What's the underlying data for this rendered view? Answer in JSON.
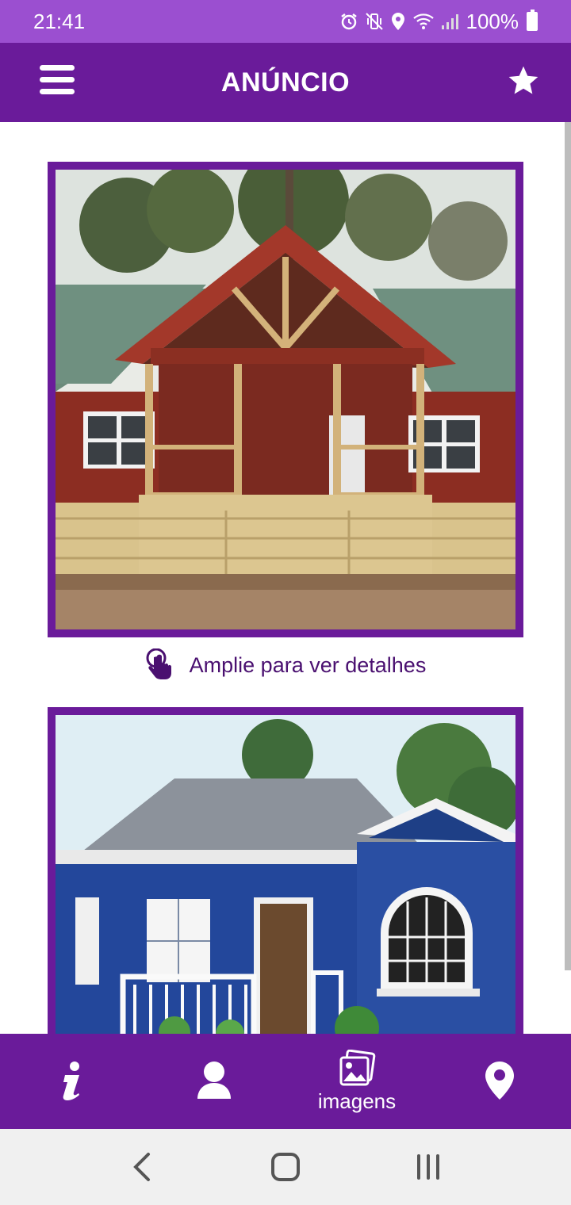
{
  "status_bar": {
    "time": "21:41",
    "battery": "100%",
    "icons": [
      "alarm-icon",
      "vibrate-icon",
      "location-icon",
      "wifi-icon",
      "signal-icon",
      "battery-icon"
    ]
  },
  "app_bar": {
    "title": "ANÚNCIO",
    "menu_icon": "hamburger-menu-icon",
    "favorite_icon": "star-icon"
  },
  "content": {
    "images": [
      {
        "description_icon": "photo-house-red"
      },
      {
        "description_icon": "photo-house-blue"
      }
    ],
    "zoom_hint": "Amplie para ver detalhes"
  },
  "bottom_nav": {
    "items": [
      {
        "icon": "info-icon",
        "label": ""
      },
      {
        "icon": "user-icon",
        "label": ""
      },
      {
        "icon": "images-icon",
        "label": "imagens"
      },
      {
        "icon": "location-pin-icon",
        "label": ""
      }
    ]
  },
  "colors": {
    "status_bar": "#9b4fd0",
    "primary": "#6a1b9a",
    "hint_text": "#4a1070"
  }
}
